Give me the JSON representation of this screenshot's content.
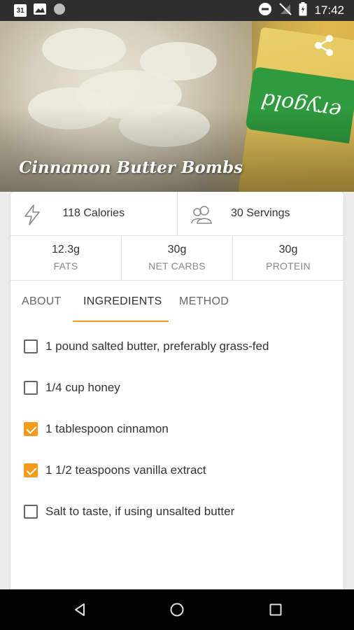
{
  "status_bar": {
    "time": "17:42",
    "calendar_day": "31",
    "left_icons": [
      "calendar-icon",
      "image-icon",
      "circle-icon"
    ],
    "right_icons": [
      "do-not-disturb-icon",
      "no-signal-icon",
      "battery-icon"
    ]
  },
  "hero": {
    "title": "Cinnamon Butter Bombs",
    "pack_text": "erygold"
  },
  "stats": {
    "calories": "118 Calories",
    "servings": "30 Servings"
  },
  "macros": [
    {
      "value": "12.3g",
      "label": "FATS"
    },
    {
      "value": "30g",
      "label": "NET CARBS"
    },
    {
      "value": "30g",
      "label": "PROTEIN"
    }
  ],
  "tabs": [
    {
      "label": "ABOUT",
      "active": false
    },
    {
      "label": "INGREDIENTS",
      "active": true
    },
    {
      "label": "METHOD",
      "active": false
    }
  ],
  "ingredients": [
    {
      "text": "1 pound salted butter, preferably grass-fed",
      "checked": false
    },
    {
      "text": "1/4 cup honey",
      "checked": false
    },
    {
      "text": "1 tablespoon cinnamon",
      "checked": true
    },
    {
      "text": "1 1/2 teaspoons vanilla extract",
      "checked": true
    },
    {
      "text": "Salt to taste, if using unsalted butter",
      "checked": false
    }
  ],
  "colors": {
    "accent": "#f59b1c",
    "status_bar": "#2e2e2e",
    "nav_bar": "#000000"
  },
  "nav": [
    "back-icon",
    "home-icon",
    "recents-icon"
  ]
}
